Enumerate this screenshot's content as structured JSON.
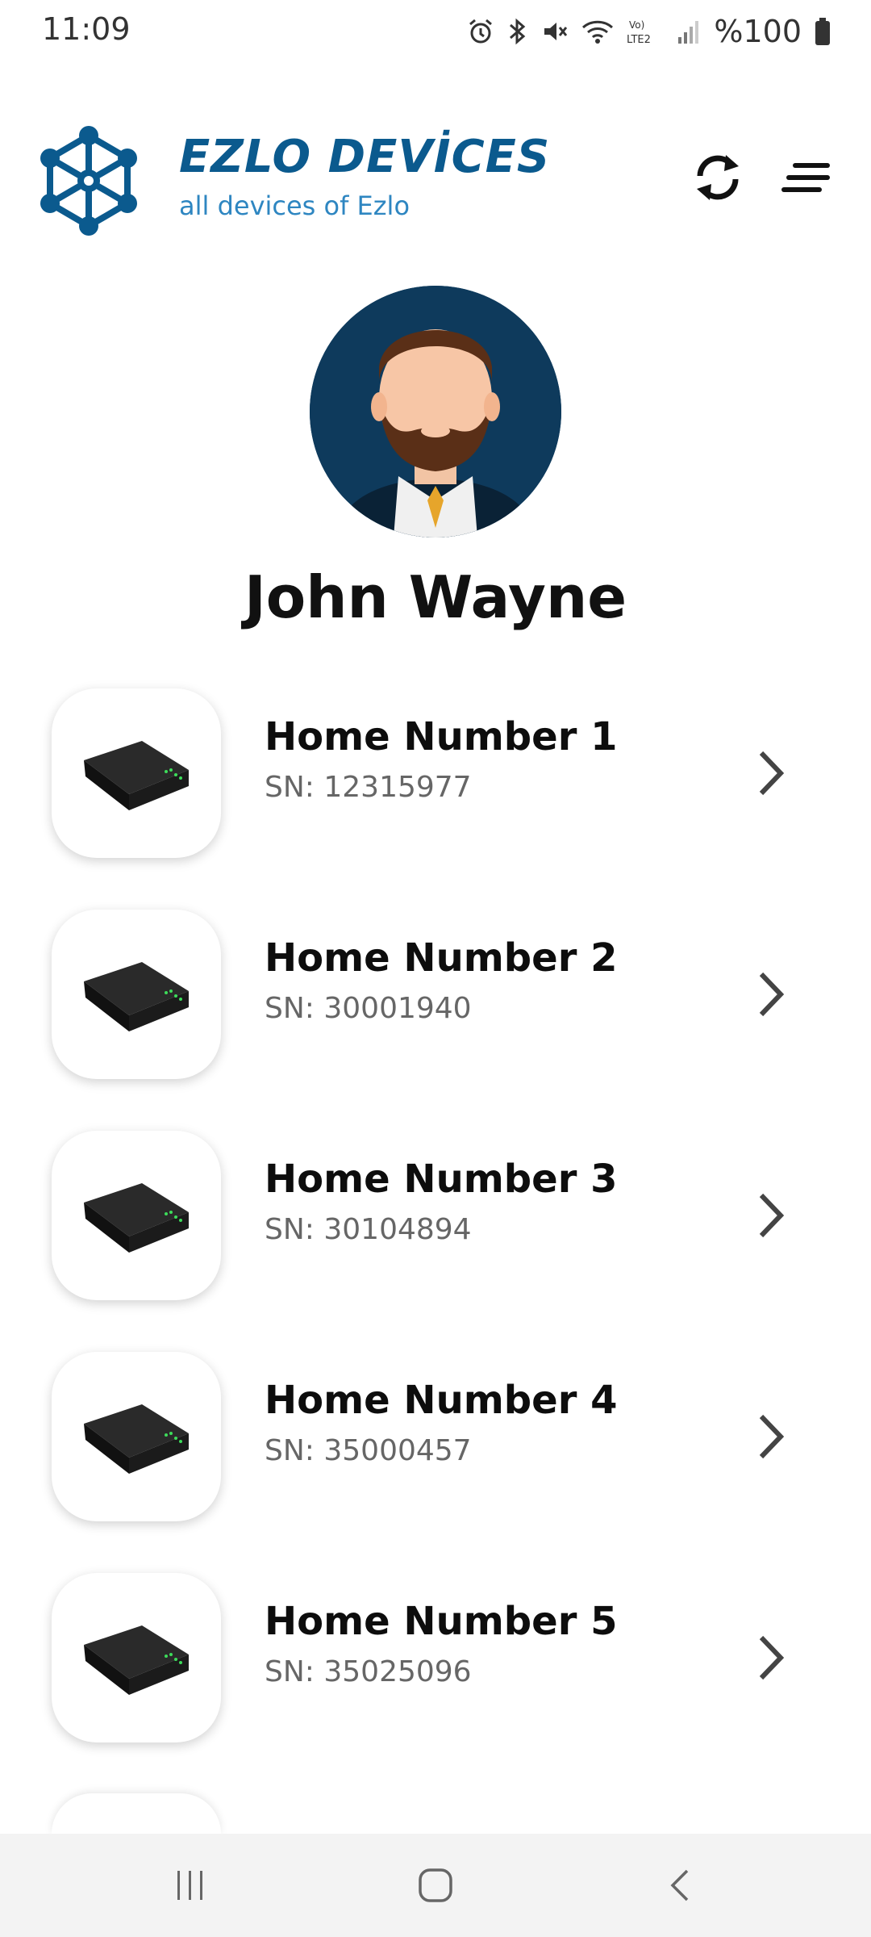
{
  "status_bar": {
    "time": "11:09",
    "battery": "%100"
  },
  "header": {
    "title": "EZLO DEVİCES",
    "subtitle": "all devices of Ezlo"
  },
  "profile": {
    "name": "John Wayne"
  },
  "devices": [
    {
      "name": "Home Number 1",
      "sn": "SN: 12315977"
    },
    {
      "name": "Home Number 2",
      "sn": "SN: 30001940"
    },
    {
      "name": "Home Number 3",
      "sn": "SN: 30104894"
    },
    {
      "name": "Home Number 4",
      "sn": "SN: 35000457"
    },
    {
      "name": "Home Number 5",
      "sn": "SN: 35025096"
    }
  ],
  "colors": {
    "brand": "#0b5a8e",
    "subtitle": "#2e86c1",
    "avatar_bg": "#0e3a5c"
  },
  "icons": {
    "status": [
      "alarm-icon",
      "bluetooth-icon",
      "mute-icon",
      "wifi-icon",
      "lte-icon",
      "signal-icon",
      "battery-icon"
    ],
    "header": [
      "logo-icon",
      "refresh-icon",
      "menu-icon"
    ],
    "nav": [
      "recent-apps-icon",
      "home-icon",
      "back-icon"
    ]
  }
}
